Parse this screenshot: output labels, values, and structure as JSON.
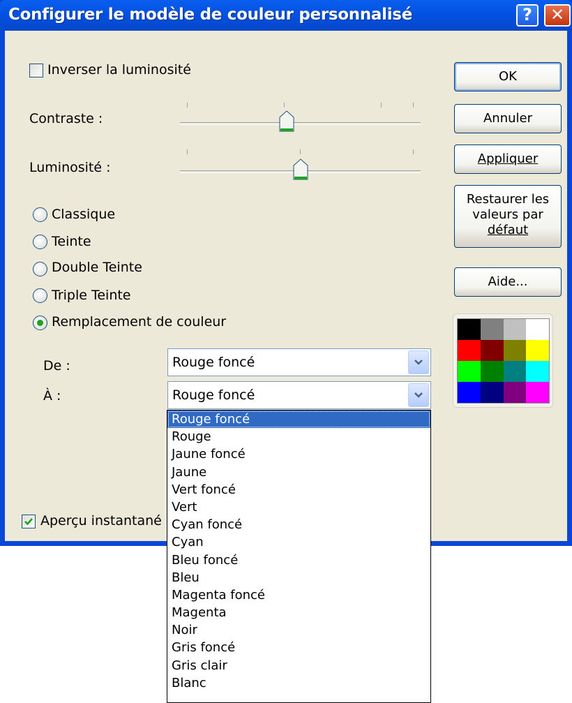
{
  "window": {
    "title": "Configurer le modèle de couleur personnalisé"
  },
  "titlebar": {
    "help_glyph": "?",
    "close_glyph": "✕"
  },
  "options": {
    "invert_label": "Inverser la luminosité",
    "invert_checked": false,
    "contrast_label": "Contraste :",
    "brightness_label": "Luminosité :",
    "contrast_value_fraction": 0.44,
    "brightness_value_fraction": 0.5
  },
  "modes": [
    {
      "label": "Classique",
      "selected": false
    },
    {
      "label": "Teinte",
      "selected": false
    },
    {
      "label": "Double Teinte",
      "selected": false
    },
    {
      "label": "Triple Teinte",
      "selected": false
    },
    {
      "label": "Remplacement de couleur",
      "selected": true
    }
  ],
  "replace": {
    "from_label": "De :",
    "from_value": "Rouge foncé",
    "to_label": "À :",
    "to_value": "Rouge foncé"
  },
  "dropdown": {
    "items": [
      "Rouge foncé",
      "Rouge",
      "Jaune foncé",
      "Jaune",
      "Vert foncé",
      "Vert",
      "Cyan foncé",
      "Cyan",
      "Bleu foncé",
      "Bleu",
      "Magenta foncé",
      "Magenta",
      "Noir",
      "Gris foncé",
      "Gris clair",
      "Blanc"
    ],
    "selected_index": 0
  },
  "preview": {
    "label": "Aperçu instantané",
    "checked": true
  },
  "buttons": {
    "ok": "OK",
    "cancel": "Annuler",
    "apply": "Appliquer",
    "restore_line1": "Restaurer les",
    "restore_line2": "valeurs par",
    "restore_line3": "défaut",
    "help": "Aide..."
  },
  "palette": [
    "#000000",
    "#808080",
    "#c0c0c0",
    "#ffffff",
    "#ff0000",
    "#800000",
    "#808000",
    "#ffff00",
    "#00ff00",
    "#008000",
    "#008080",
    "#00ffff",
    "#0000ff",
    "#000080",
    "#800080",
    "#ff00ff"
  ],
  "colors": {
    "title_bar": "#0351e2",
    "face": "#ece9d8",
    "selection": "#316ac5",
    "radio_dot": "#21a121"
  }
}
